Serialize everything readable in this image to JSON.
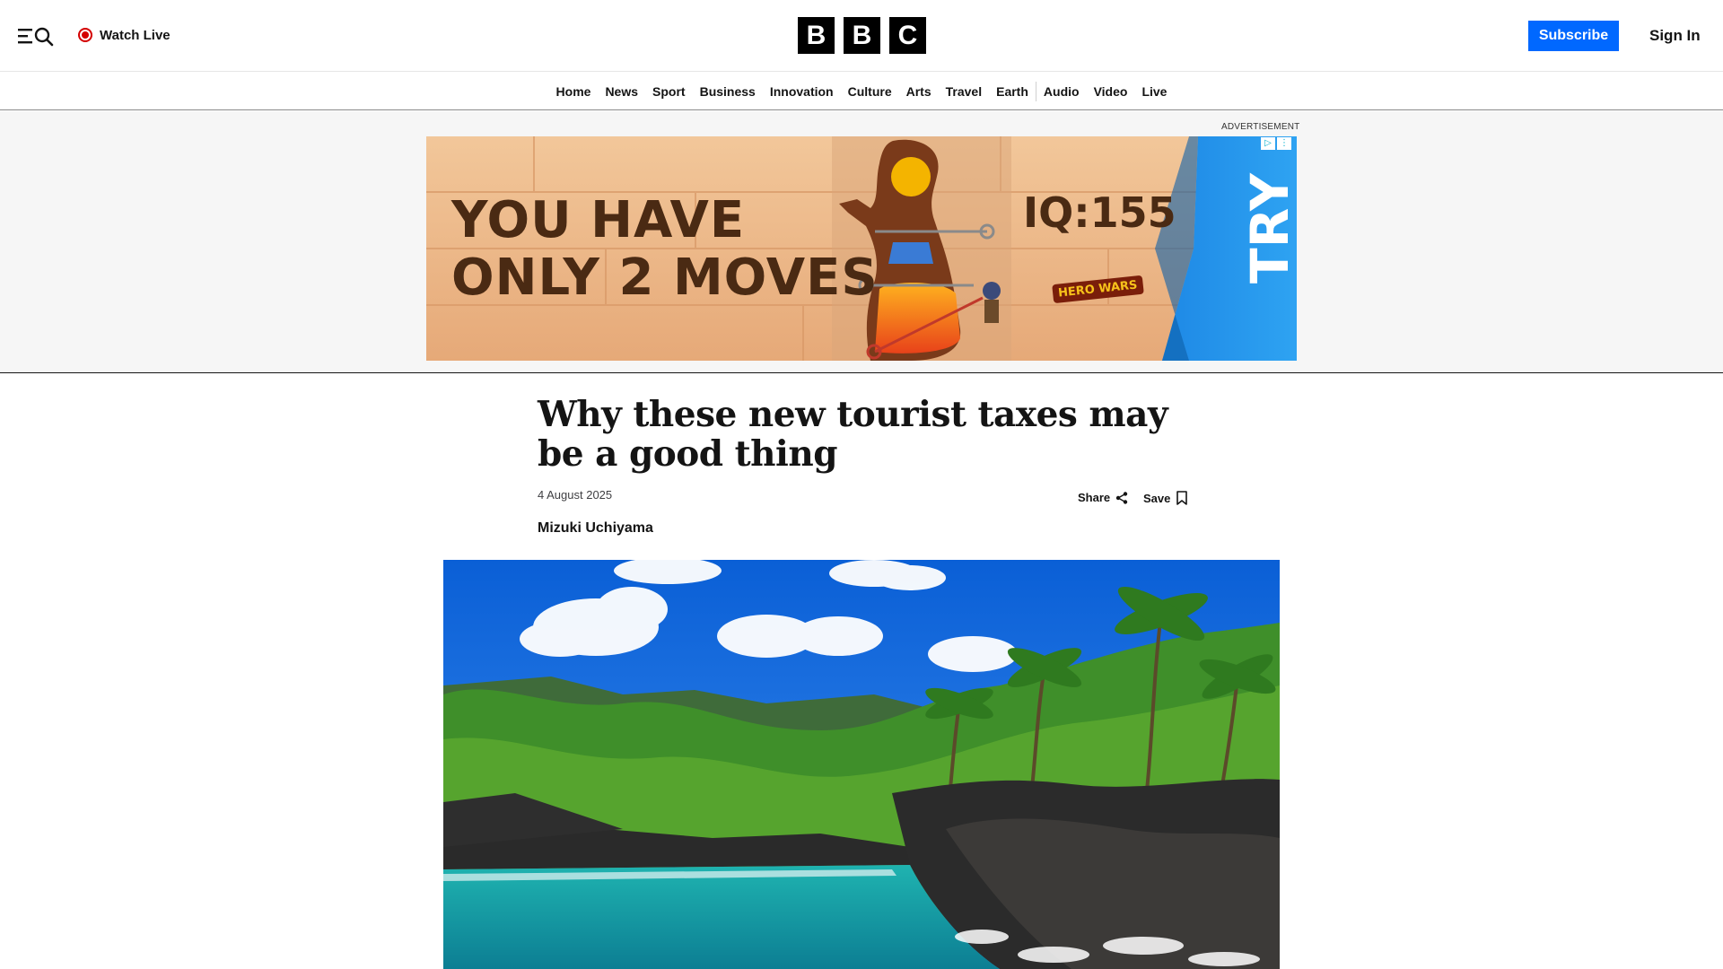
{
  "header": {
    "watch_live_label": "Watch Live",
    "logo_letters": [
      "B",
      "B",
      "C"
    ],
    "subscribe_label": "Subscribe",
    "sign_in_label": "Sign In",
    "accent_color": "#0068ff",
    "live_color": "#d40000"
  },
  "nav": {
    "items": [
      "Home",
      "News",
      "Sport",
      "Business",
      "Innovation",
      "Culture",
      "Arts",
      "Travel",
      "Earth",
      "Audio",
      "Video",
      "Live"
    ]
  },
  "ad": {
    "label": "ADVERTISEMENT",
    "headline_line1": "YOU HAVE",
    "headline_line2": "ONLY 2 MOVES",
    "iq_text": "IQ:155",
    "brand": "HERO WARS",
    "cta": "TRY"
  },
  "article": {
    "headline": "Why these new tourist taxes may be a good thing",
    "date": "4 August 2025",
    "byline": "Mizuki Uchiyama",
    "share_label": "Share",
    "save_label": "Save"
  }
}
